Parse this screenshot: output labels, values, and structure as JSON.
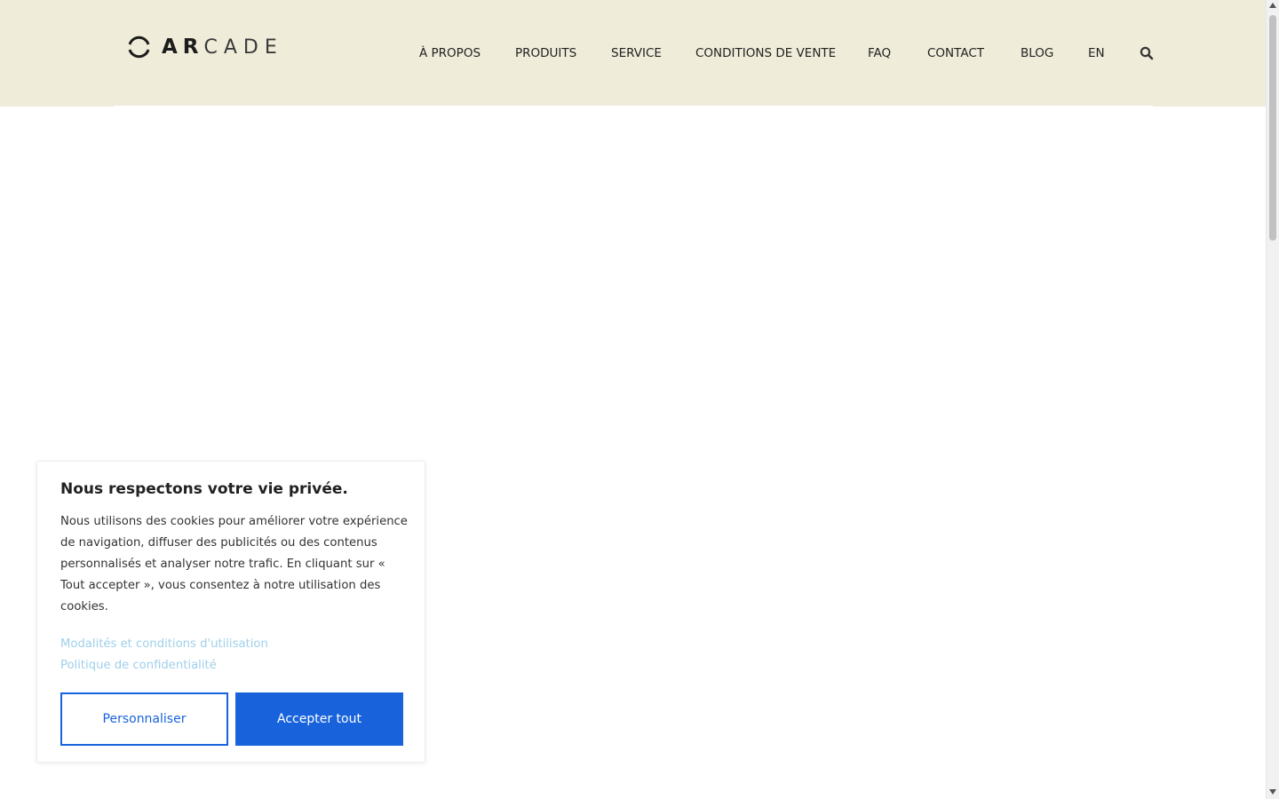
{
  "brand": {
    "logo_bold": "AR",
    "logo_light": "CADE"
  },
  "nav": {
    "items": [
      {
        "label": "À PROPOS"
      },
      {
        "label": "PRODUITS"
      },
      {
        "label": "SERVICE"
      },
      {
        "label": "CONDITIONS DE VENTE"
      },
      {
        "label": "FAQ"
      },
      {
        "label": "CONTACT"
      },
      {
        "label": "BLOG"
      },
      {
        "label": "EN"
      }
    ],
    "search_icon": "search-icon"
  },
  "cookie_banner": {
    "title": "Nous respectons votre vie privée.",
    "body": "Nous utilisons des cookies pour améliorer votre expérience de navigation, diffuser des publicités ou des contenus personnalisés et analyser notre trafic. En cliquant sur « Tout accepter », vous consentez à notre utilisation des cookies.",
    "links": {
      "terms": "Modalités et conditions d'utilisation",
      "privacy": "Politique de confidentialité"
    },
    "buttons": {
      "customize": "Personnaliser",
      "accept_all": "Accepter tout"
    }
  },
  "colors": {
    "header_bg": "#efecd9",
    "accent": "#1863dc",
    "link": "#9fd0ea"
  }
}
